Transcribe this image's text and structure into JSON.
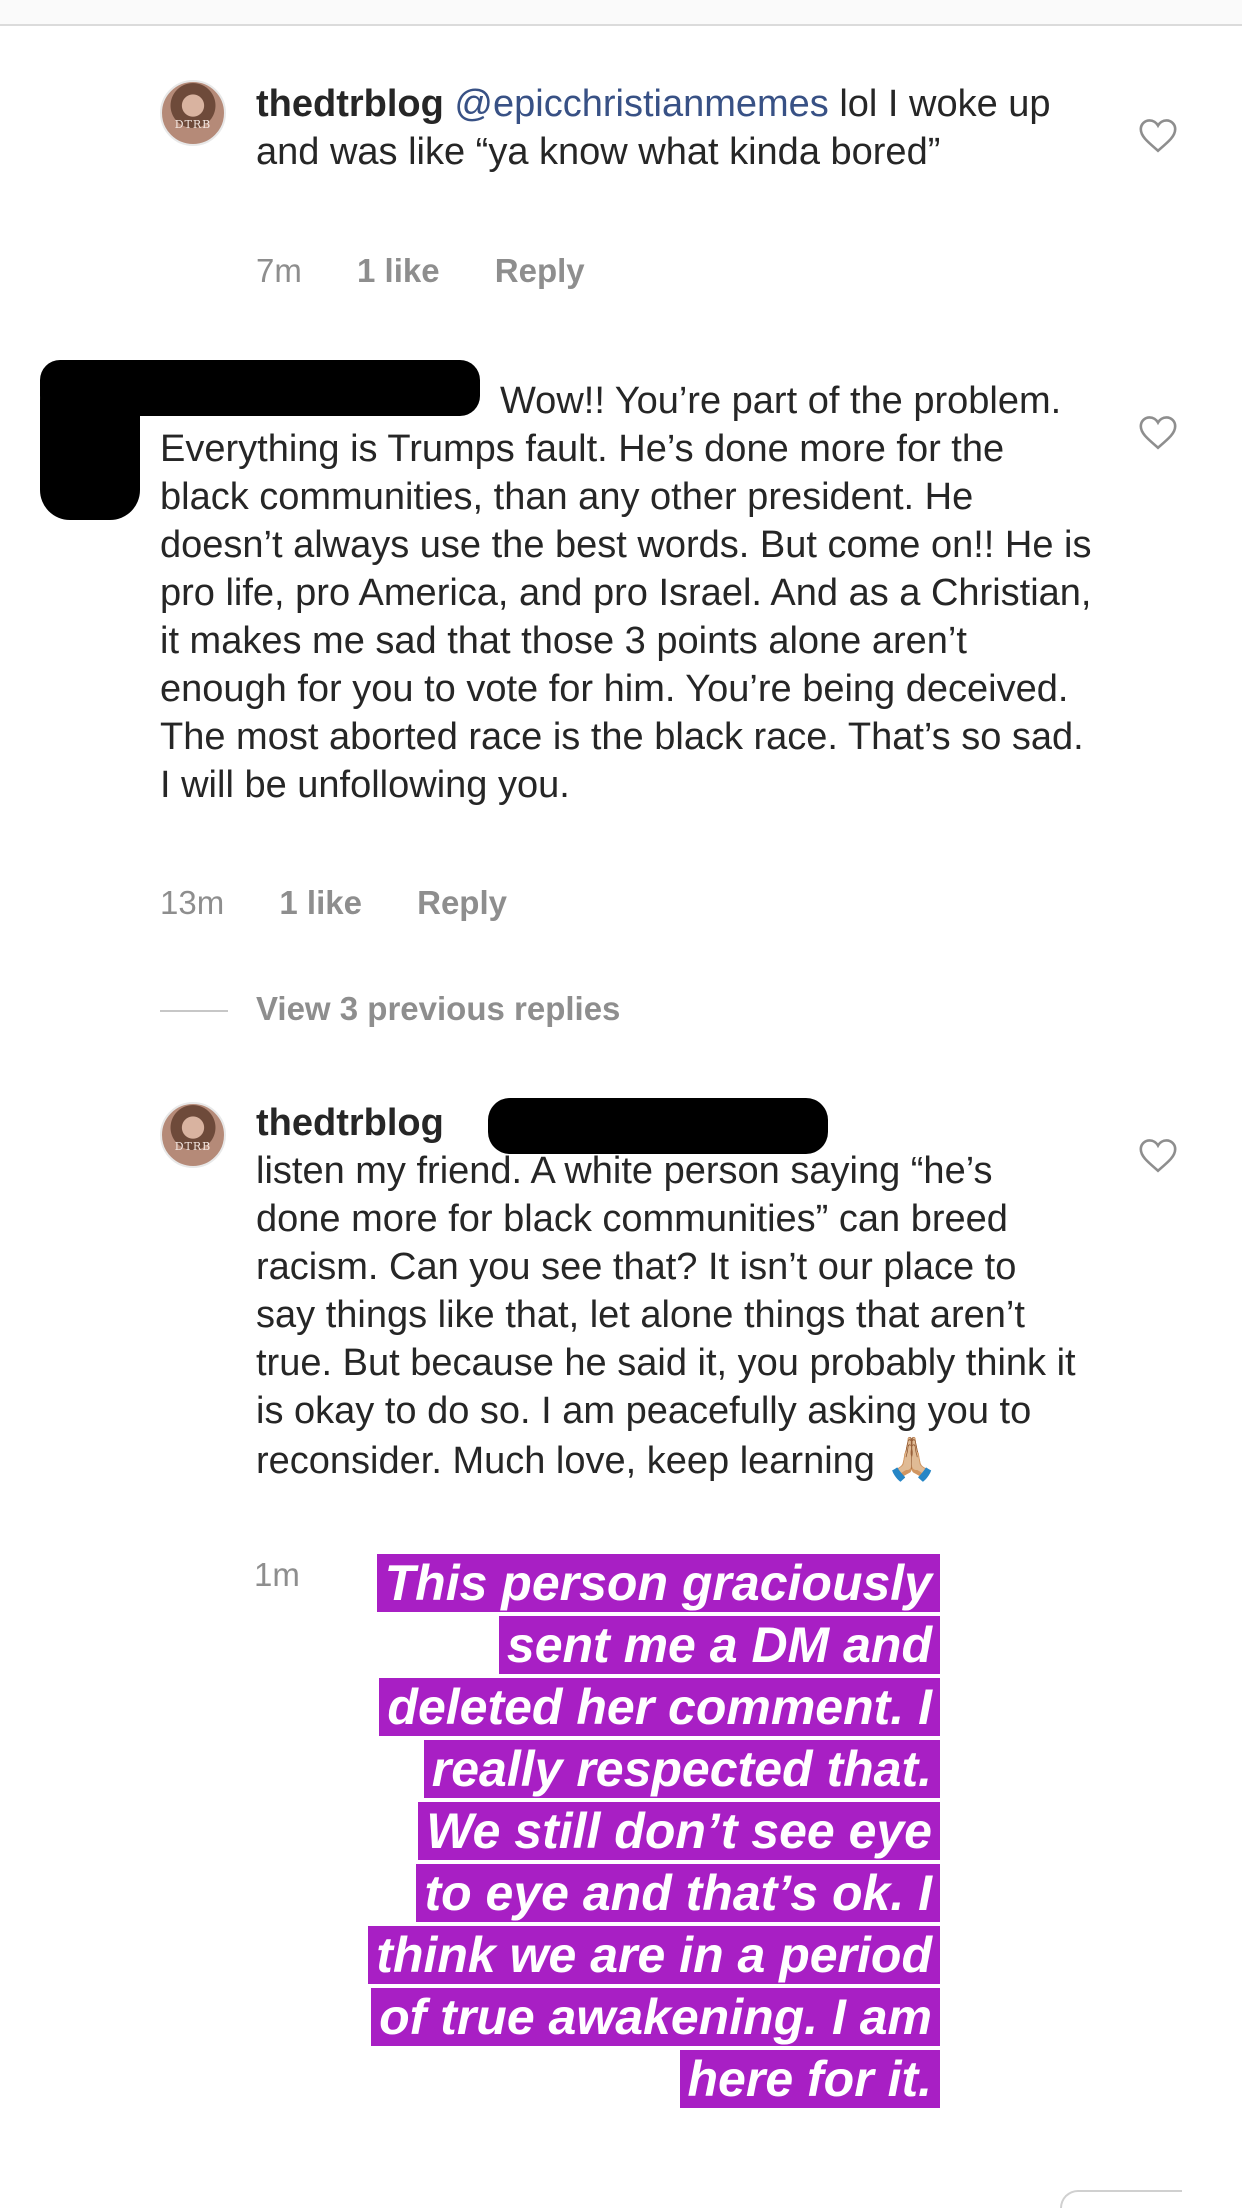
{
  "comments": [
    {
      "username": "thedtrblog",
      "mention": "@epicchristianmemes",
      "text": "lol I woke up and was like “ya know what kinda bored”",
      "time": "7m",
      "likes": "1 like",
      "reply_label": "Reply",
      "avatar_text": "DTRB"
    },
    {
      "text": "Wow!! You’re part of the problem. Everything is Trumps fault. He’s done more for the black communities, than any other president. He doesn’t always use the best words. But come on!! He is pro life, pro America, and pro Israel. And as a Christian, it makes me sad that those 3 points alone aren’t enough for you to vote for him. You’re being deceived. The most aborted race is the black race. That’s so sad. I will be unfollowing you.",
      "time": "13m",
      "likes": "1 like",
      "reply_label": "Reply"
    },
    {
      "username": "thedtrblog",
      "text": "listen my friend. A white person saying “he’s done more for black communities” can breed racism. Can you see that? It isn’t our place to say things like that, let alone things that aren’t true. But because he said it, you probably think it is okay to do so. I am peacefully asking you to reconsider. Much love, keep learning",
      "emoji": "🙏🏼",
      "time": "1m",
      "avatar_text": "DTRB"
    }
  ],
  "view_replies_label": "View 3 previous replies",
  "story_text_lines": [
    "This person graciously",
    "sent me a DM and",
    "deleted her comment. I",
    "really respected that.",
    "We still don’t see eye",
    "to eye and that’s ok. I",
    "think we are in a period",
    "of true awakening. I am",
    "here for it."
  ],
  "colors": {
    "highlight": "#a81fc4",
    "mention": "#385185",
    "meta": "#8e8e8e"
  },
  "icons": {
    "like": "heart-outline-icon"
  }
}
